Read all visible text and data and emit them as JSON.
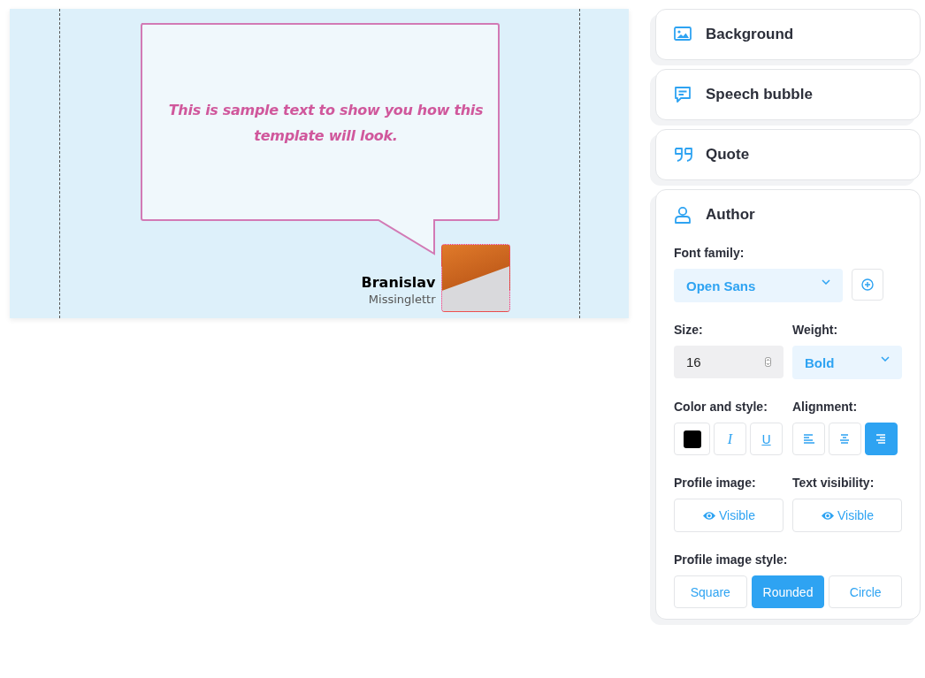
{
  "preview": {
    "quote": "This is sample text to show you how this template will look.",
    "author_name": "Branislav",
    "author_title": "Missinglettr"
  },
  "sections": [
    {
      "label": "Background",
      "kind": "background",
      "expanded": false
    },
    {
      "label": "Speech bubble",
      "kind": "bubble",
      "expanded": false
    },
    {
      "label": "Quote",
      "kind": "quote",
      "expanded": false
    },
    {
      "label": "Author",
      "kind": "author",
      "expanded": true
    }
  ],
  "author_settings": {
    "font_family_label": "Font family:",
    "font_family": "Open Sans",
    "size_label": "Size:",
    "size": "16",
    "weight_label": "Weight:",
    "weight": "Bold",
    "color_style_label": "Color and style:",
    "color": "#000000",
    "italic": {
      "glyph": "I",
      "selected": false
    },
    "underline": {
      "glyph": "U",
      "selected": false
    },
    "alignment_label": "Alignment:",
    "alignments": [
      {
        "kind": "left",
        "selected": false
      },
      {
        "kind": "center",
        "selected": false
      },
      {
        "kind": "right",
        "selected": true
      }
    ],
    "profile_image_label": "Profile image:",
    "profile_image_button": "Visible",
    "text_visibility_label": "Text visibility:",
    "text_visibility_button": "Visible",
    "profile_image_style_label": "Profile image style:",
    "styles": [
      {
        "label": "Square",
        "selected": false
      },
      {
        "label": "Rounded",
        "selected": true
      },
      {
        "label": "Circle",
        "selected": false
      }
    ]
  }
}
